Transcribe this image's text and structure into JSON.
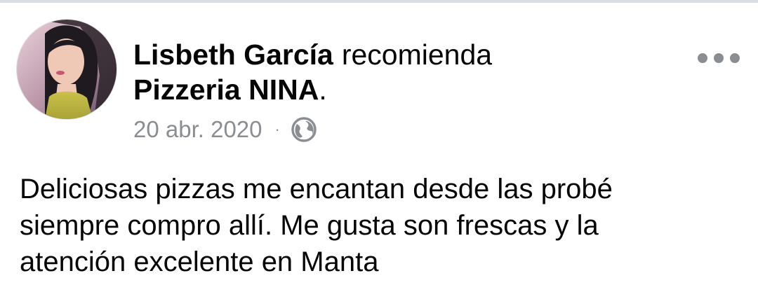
{
  "post": {
    "author_name": "Lisbeth García",
    "action_verb": "recomienda",
    "page_name": "Pizzeria NINA",
    "page_suffix": ".",
    "date": "20 abr. 2020",
    "separator": "·",
    "privacy_icon": "globe-icon",
    "more_icon": "more-options-icon",
    "body_lines": [
      "Deliciosas pizzas me encantan desde las probé",
      "siempre compro allí. Me gusta son frescas y la",
      "atención excelente en Manta"
    ]
  },
  "colors": {
    "text_primary": "#050505",
    "text_secondary": "#8a8d91",
    "divider": "#dadde1",
    "background": "#ffffff"
  }
}
